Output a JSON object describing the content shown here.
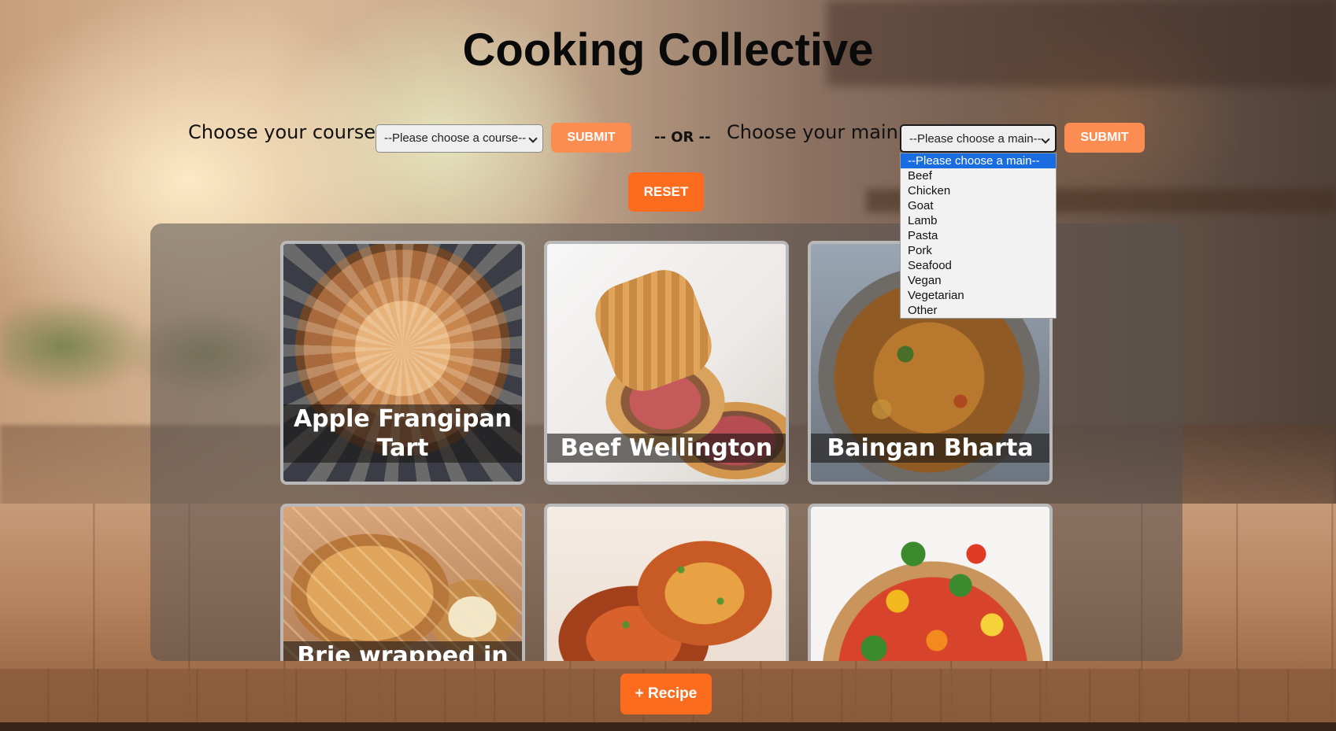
{
  "page": {
    "title": "Cooking Collective"
  },
  "filters": {
    "course": {
      "label": "Choose your course:",
      "selected": "--Please choose a course--",
      "submit_label": "SUBMIT"
    },
    "separator": "-- OR --",
    "main": {
      "label": "Choose your main:",
      "selected": "--Please choose a main--",
      "submit_label": "SUBMIT",
      "options": [
        "--Please choose a main--",
        "Beef",
        "Chicken",
        "Goat",
        "Lamb",
        "Pasta",
        "Pork",
        "Seafood",
        "Vegan",
        "Vegetarian",
        "Other"
      ]
    },
    "reset_label": "RESET"
  },
  "recipes": [
    {
      "title": "Apple Frangipan Tart"
    },
    {
      "title": "Beef Wellington"
    },
    {
      "title": "Baingan Bharta"
    },
    {
      "title": "Brie wrapped in"
    },
    {
      "title": ""
    },
    {
      "title": ""
    }
  ],
  "footer": {
    "add_recipe_label": "+ Recipe"
  },
  "colors": {
    "submit": "#fb8d52",
    "primary": "#fb6c1f",
    "dropdown_highlight": "#1a6de0"
  }
}
